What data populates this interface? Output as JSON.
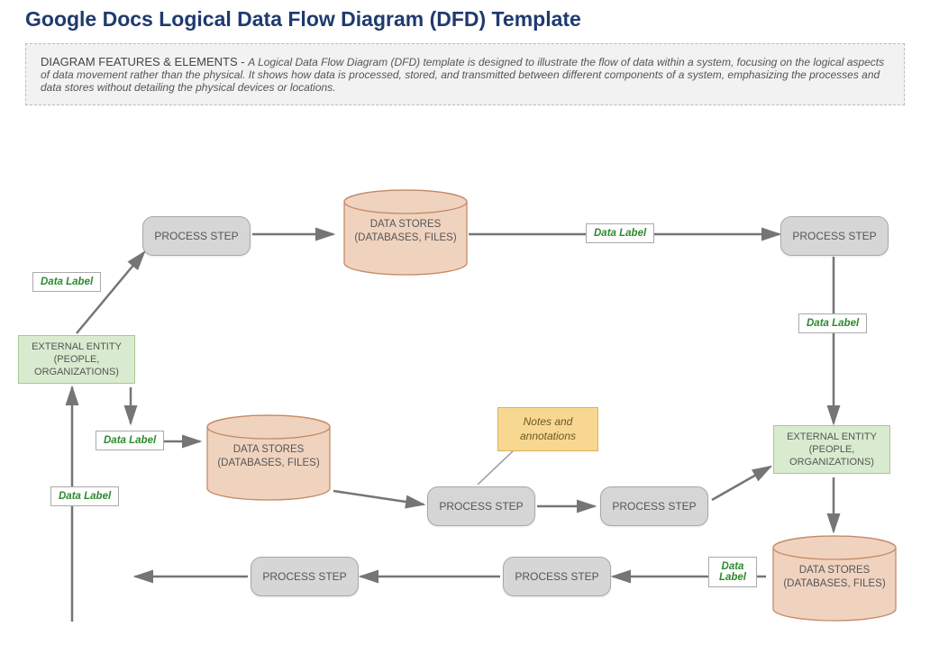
{
  "title": "Google Docs Logical Data Flow Diagram (DFD) Template",
  "features": {
    "lead": "DIAGRAM FEATURES & ELEMENTS - ",
    "desc": "A Logical Data Flow Diagram (DFD) template is designed to illustrate the flow of data within a system, focusing on the logical aspects of data movement rather than the physical. It shows how data is processed, stored, and transmitted between different components of a system, emphasizing the processes and data stores without detailing the physical devices or locations."
  },
  "nodes": {
    "process_top_left": "PROCESS  STEP",
    "process_top_right": "PROCESS  STEP",
    "process_mid_left": "PROCESS  STEP",
    "process_mid_right": "PROCESS  STEP",
    "process_bot_left": "PROCESS  STEP",
    "process_bot_mid": "PROCESS  STEP",
    "entity_left": "EXTERNAL ENTITY (PEOPLE, ORGANIZATIONS)",
    "entity_right": "EXTERNAL ENTITY (PEOPLE, ORGANIZATIONS)",
    "datastore_top": "DATA STORES (DATABASES, FILES)",
    "datastore_mid": "DATA STORES (DATABASES, FILES)",
    "datastore_bot": "DATA STORES (DATABASES, FILES)"
  },
  "labels": {
    "dl1": "Data Label",
    "dl2": "Data Label",
    "dl3": "Data Label",
    "dl4": "Data Label",
    "dl5": "Data Label",
    "dl6": "Data Label"
  },
  "note": "Notes and annotations",
  "colors": {
    "title": "#1f3a6e",
    "process_fill": "#d6d6d6",
    "entity_fill": "#d8ebcf",
    "datastore_fill": "#f0d3bf",
    "note_fill": "#f8d890",
    "label_text": "#2d8a2d",
    "arrow": "#757575"
  }
}
